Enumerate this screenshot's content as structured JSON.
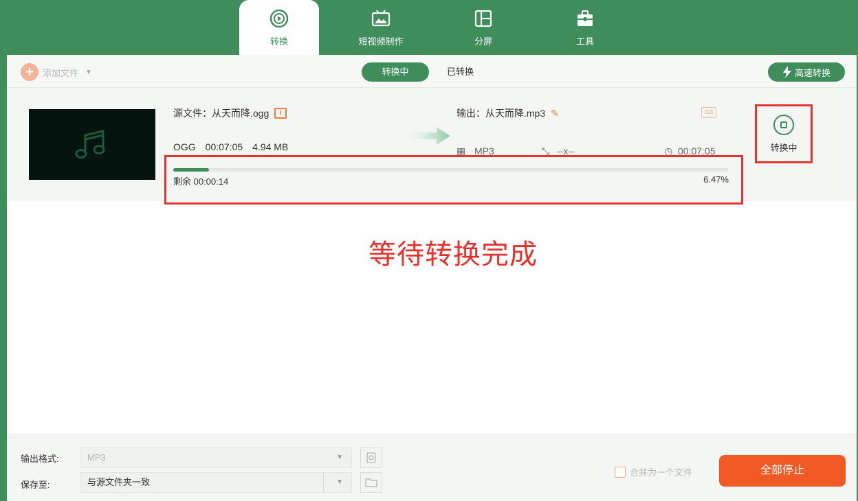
{
  "tabs": [
    {
      "label": "转换",
      "icon": "convert-icon",
      "active": true
    },
    {
      "label": "短视频制作",
      "icon": "video-maker-icon",
      "active": false
    },
    {
      "label": "分屏",
      "icon": "split-screen-icon",
      "active": false
    },
    {
      "label": "工具",
      "icon": "toolbox-icon",
      "active": false
    }
  ],
  "toolbar": {
    "add_file_label": "添加文件",
    "seg_converting": "转换中",
    "seg_converted": "已转换",
    "fast_convert_label": "高速转换"
  },
  "file": {
    "source_label": "源文件：从天而降.ogg",
    "src_format": "OGG",
    "src_duration": "00:07:05",
    "src_size": "4.94 MB",
    "output_label": "输出：从天而降.mp3",
    "out_format": "MP3",
    "out_resolution": "--x--",
    "out_duration": "00:07:05",
    "remaining": "剩余 00:00:14",
    "progress_percent": "6.47%",
    "progress_value": 6.47,
    "status_label": "转换中"
  },
  "annotation": {
    "text": "等待转换完成"
  },
  "footer": {
    "format_label": "输出格式:",
    "format_value": "MP3",
    "save_label": "保存至:",
    "save_value": "与源文件夹一致",
    "merge_label": "合并为一个文件",
    "stop_all_label": "全部停止"
  },
  "colors": {
    "brand_green": "#3e8d5b",
    "accent_orange": "#f15a24",
    "annotation_red": "#e3342f"
  }
}
